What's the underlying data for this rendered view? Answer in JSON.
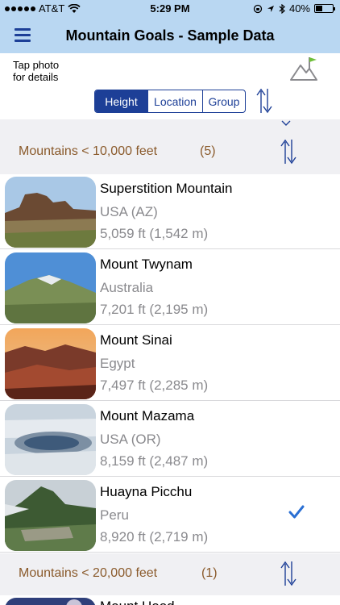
{
  "status": {
    "carrier": "AT&T",
    "time": "5:29 PM",
    "battery": "40%",
    "battery_level": 0.4
  },
  "nav": {
    "title": "Mountain Goals - Sample Data",
    "menu_icon": "hamburger-menu-icon"
  },
  "toolbar": {
    "hint_line1": "Tap photo",
    "hint_line2": "for details",
    "segments": [
      "Height",
      "Location",
      "Group"
    ],
    "selected_segment": "Height",
    "flag_icon": "mountain-flag-icon",
    "sort_icon": "sort-arrows-icon"
  },
  "sections": [
    {
      "label": "Mountains < 10,000 feet",
      "count": "(5)"
    },
    {
      "label": "Mountains < 20,000 feet",
      "count": "(1)"
    }
  ],
  "mountains": [
    {
      "name": "Superstition Mountain",
      "location": "USA (AZ)",
      "height": "5,059 ft (1,542 m)",
      "checked": false
    },
    {
      "name": "Mount Twynam",
      "location": "Australia",
      "height": "7,201 ft (2,195 m)",
      "checked": false
    },
    {
      "name": "Mount Sinai",
      "location": "Egypt",
      "height": "7,497 ft (2,285 m)",
      "checked": false
    },
    {
      "name": "Mount Mazama",
      "location": "USA (OR)",
      "height": "8,159 ft (2,487 m)",
      "checked": false
    },
    {
      "name": "Huayna Picchu",
      "location": "Peru",
      "height": "8,920 ft (2,719 m)",
      "checked": true
    }
  ],
  "next_row": {
    "name": "Mount Hood"
  },
  "colors": {
    "nav_bg": "#b9d7f2",
    "accent": "#1d3f97",
    "section_text": "#8a5a2b",
    "check": "#2a6fd3"
  }
}
